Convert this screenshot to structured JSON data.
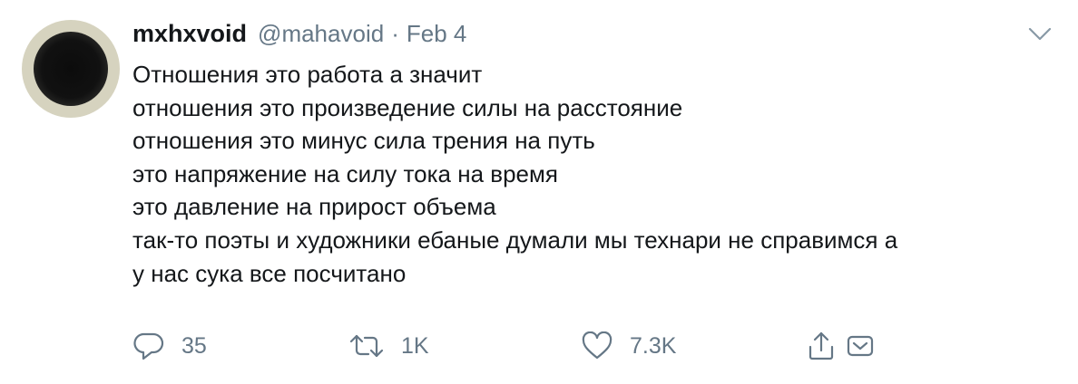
{
  "tweet": {
    "author_name": "mxhxvoid",
    "author_handle": "@mahavoid",
    "separator": "·",
    "date": "Feb 4",
    "text_lines": [
      "Отношения это работа а значит",
      "отношения это произведение силы на расстояние",
      "отношения это минус сила трения на путь",
      "это напряжение на силу тока на время",
      "это давление на прирост объема",
      "так-то поэты и художники ебаные думали мы технари не справимся а",
      "у нас сука все посчитано"
    ],
    "replies": "35",
    "retweets": "1K",
    "likes": "7.3K"
  },
  "icons": {
    "menu": "chevron-down-icon",
    "reply": "reply-icon",
    "retweet": "retweet-icon",
    "like": "heart-icon",
    "share": "share-icon",
    "dm": "direct-message-icon"
  },
  "colors": {
    "text": "#14171a",
    "secondary": "#657786",
    "background": "#ffffff"
  }
}
